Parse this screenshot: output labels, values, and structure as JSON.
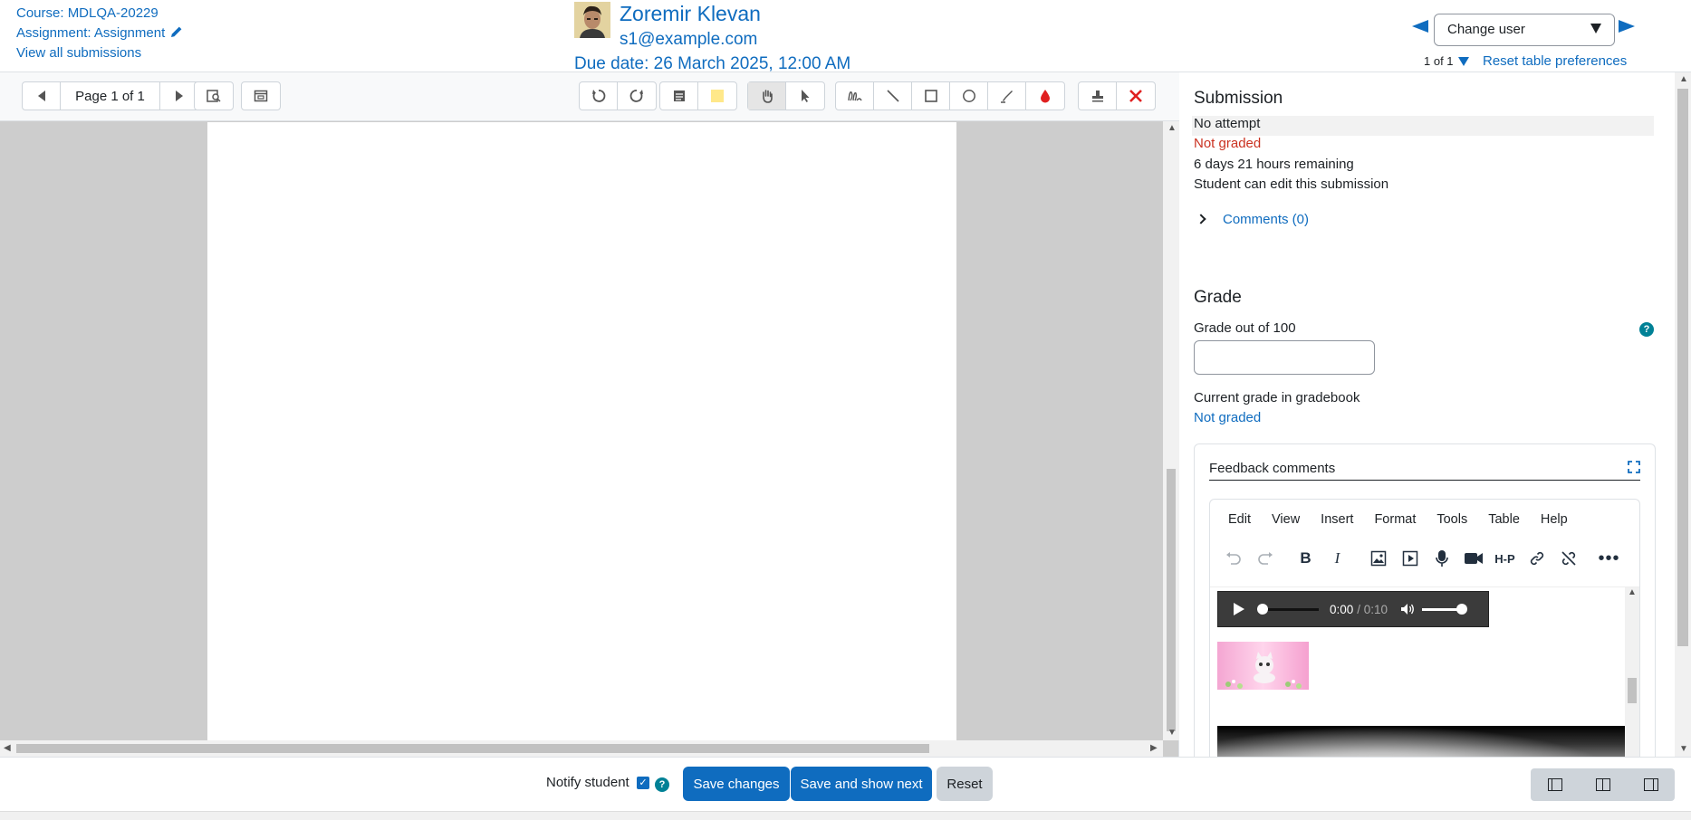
{
  "header": {
    "course": "Course: MDLQA-20229",
    "assignment": "Assignment: Assignment",
    "view_all": "View all submissions",
    "user_name": "Zoremir Klevan",
    "user_email": "s1@example.com",
    "due_date": "Due date: 26 March 2025, 12:00 AM",
    "change_user": "Change user",
    "count": "1 of 1",
    "reset_prefs": "Reset table preferences"
  },
  "viewer": {
    "page_label": "Page 1 of 1"
  },
  "submission": {
    "heading": "Submission",
    "status": "No attempt",
    "grading_status": "Not graded",
    "time_remaining": "6 days 21 hours remaining",
    "edit_status": "Student can edit this submission",
    "comments_link": "Comments (0)"
  },
  "grade": {
    "heading": "Grade",
    "grade_label": "Grade out of 100",
    "grade_value": "",
    "current_label": "Current grade in gradebook",
    "current_value": "Not graded"
  },
  "feedback": {
    "label": "Feedback comments",
    "menu": [
      "Edit",
      "View",
      "Insert",
      "Format",
      "Tools",
      "Table",
      "Help"
    ],
    "audio_time": "0:00",
    "audio_duration": "/ 0:10",
    "audio_progress": 0
  },
  "footer": {
    "notify_label": "Notify student",
    "notify_checked": true,
    "save_changes": "Save changes",
    "save_next": "Save and show next",
    "reset": "Reset"
  },
  "colors": {
    "link": "#0f6cbf",
    "danger": "#ca3120",
    "help": "#008196",
    "primary_button": "#0f6cbf"
  }
}
